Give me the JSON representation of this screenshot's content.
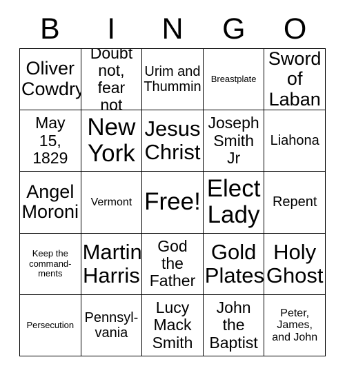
{
  "card": {
    "header_letters": [
      "B",
      "I",
      "N",
      "G",
      "O"
    ],
    "columns": 5,
    "rows": 5,
    "border_color": "#000000",
    "background_color": "#ffffff",
    "text_color": "#000000",
    "free_space": {
      "row": 3,
      "column": 3,
      "label": "Free!"
    },
    "cells": [
      {
        "text": "Oliver\nCowdry",
        "size": "fs-xl"
      },
      {
        "text": "Doubt\nnot, fear\nnot",
        "size": "fs-l"
      },
      {
        "text": "Urim and\nThummin",
        "size": "fs-m"
      },
      {
        "text": "Breastplate",
        "size": "fs-xs"
      },
      {
        "text": "Sword\nof\nLaban",
        "size": "fs-xl"
      },
      {
        "text": "May\n15,\n1829",
        "size": "fs-l"
      },
      {
        "text": "New\nYork",
        "size": "fs-xxxl"
      },
      {
        "text": "Jesus\nChrist",
        "size": "fs-xxl"
      },
      {
        "text": "Joseph\nSmith\nJr",
        "size": "fs-l"
      },
      {
        "text": "Liahona",
        "size": "fs-m"
      },
      {
        "text": "Angel\nMoroni",
        "size": "fs-xl"
      },
      {
        "text": "Vermont",
        "size": "fs-s"
      },
      {
        "text": "Free!",
        "size": "fs-xxxl"
      },
      {
        "text": "Elect\nLady",
        "size": "fs-xxxl"
      },
      {
        "text": "Repent",
        "size": "fs-m"
      },
      {
        "text": "Keep the\ncommand-\nments",
        "size": "fs-xs"
      },
      {
        "text": "Martin\nHarris",
        "size": "fs-xxl"
      },
      {
        "text": "God\nthe\nFather",
        "size": "fs-l"
      },
      {
        "text": "Gold\nPlates",
        "size": "fs-xxl"
      },
      {
        "text": "Holy\nGhost",
        "size": "fs-xxl"
      },
      {
        "text": "Persecution",
        "size": "fs-xs"
      },
      {
        "text": "Pennsyl-\nvania",
        "size": "fs-m"
      },
      {
        "text": "Lucy\nMack\nSmith",
        "size": "fs-l"
      },
      {
        "text": "John\nthe\nBaptist",
        "size": "fs-l"
      },
      {
        "text": "Peter,\nJames,\nand John",
        "size": "fs-s"
      }
    ]
  }
}
